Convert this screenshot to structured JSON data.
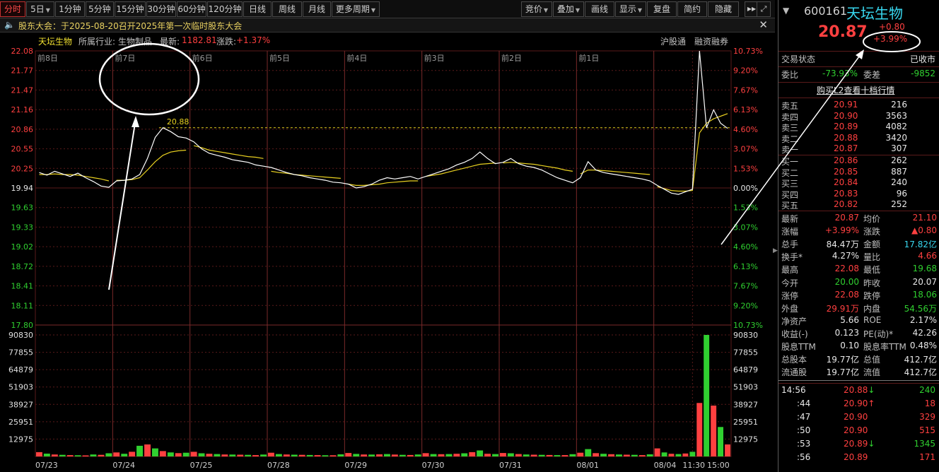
{
  "toolbar": {
    "left_buttons": [
      {
        "label": "分时",
        "active": true
      },
      {
        "label": "5日",
        "caret": true
      },
      {
        "label": "1分钟"
      },
      {
        "label": "5分钟"
      },
      {
        "label": "15分钟"
      },
      {
        "label": "30分钟"
      },
      {
        "label": "60分钟"
      },
      {
        "label": "120分钟"
      },
      {
        "label": "日线"
      },
      {
        "label": "周线"
      },
      {
        "label": "月线"
      },
      {
        "label": "更多周期",
        "caret": true
      }
    ],
    "right_buttons": [
      {
        "label": "竞价",
        "caret": true
      },
      {
        "label": "叠加",
        "caret": true
      },
      {
        "label": "画线"
      },
      {
        "label": "显示",
        "caret": true
      },
      {
        "label": "复盘"
      },
      {
        "label": "简约"
      },
      {
        "label": "隐藏"
      }
    ]
  },
  "notice": {
    "text": "股东大会：于2025-08-20召开2025年第一次临时股东大会"
  },
  "chart_info": {
    "name": "天坛生物",
    "industry_label": "所属行业:",
    "industry": "生物制品",
    "latest_label": "最新:",
    "latest": "1182.81",
    "change_label": "涨跌:",
    "change": "+1.37%",
    "tag1": "沪股通",
    "tag2": "融资融券",
    "peak_label": "20.88"
  },
  "chart_data": {
    "type": "line",
    "price_axis": [
      "22.08",
      "21.77",
      "21.47",
      "21.16",
      "20.86",
      "20.55",
      "20.25",
      "19.94",
      "19.63",
      "19.33",
      "19.02",
      "18.72",
      "18.41",
      "18.11",
      "17.80"
    ],
    "pct_axis": [
      "10.73%",
      "9.20%",
      "7.67%",
      "6.13%",
      "4.60%",
      "3.07%",
      "1.53%",
      "0.00%",
      "1.53%",
      "3.07%",
      "4.60%",
      "6.13%",
      "7.67%",
      "9.20%",
      "10.73%"
    ],
    "volume_axis": [
      "90830",
      "77855",
      "64879",
      "51903",
      "38927",
      "25951",
      "12975"
    ],
    "day_labels": [
      "前8日",
      "前7日",
      "前6日",
      "前5日",
      "前4日",
      "前3日",
      "前2日",
      "前1日"
    ],
    "date_labels": [
      "07/23",
      "07/24",
      "07/25",
      "07/28",
      "07/29",
      "07/30",
      "07/31",
      "08/01",
      "08/04",
      "11:30",
      "15:00"
    ],
    "prev_close": 20.07,
    "ylim": [
      17.8,
      22.08
    ],
    "volume_max": 90830,
    "reference_line": 20.88,
    "days": [
      {
        "price": [
          20.18,
          20.14,
          20.2,
          20.16,
          20.12,
          20.17,
          20.1,
          20.04,
          19.97,
          19.95
        ],
        "avg": [
          20.15,
          20.15,
          20.16,
          20.15,
          20.15,
          20.14,
          20.12,
          20.1,
          20.08,
          20.05
        ]
      },
      {
        "price": [
          20.05,
          20.06,
          20.08,
          20.15,
          20.4,
          20.73,
          20.88,
          20.82,
          20.74,
          20.72
        ],
        "avg": [
          20.06,
          20.06,
          20.07,
          20.1,
          20.22,
          20.35,
          20.45,
          20.5,
          20.52,
          20.53
        ]
      },
      {
        "price": [
          20.66,
          20.55,
          20.48,
          20.45,
          20.42,
          20.38,
          20.36,
          20.34,
          20.3,
          20.28
        ],
        "avg": [
          20.6,
          20.57,
          20.53,
          20.51,
          20.49,
          20.47,
          20.45,
          20.43,
          20.42,
          20.4
        ]
      },
      {
        "price": [
          20.26,
          20.22,
          20.18,
          20.15,
          20.13,
          20.1,
          20.08,
          20.06,
          20.03,
          20.02
        ],
        "avg": [
          20.2,
          20.18,
          20.17,
          20.15,
          20.14,
          20.13,
          20.12,
          20.11,
          20.1,
          20.09
        ]
      },
      {
        "price": [
          20.0,
          19.94,
          19.96,
          20.0,
          20.06,
          20.1,
          20.08,
          20.1,
          20.12,
          20.08
        ],
        "avg": [
          20.0,
          19.98,
          19.98,
          19.99,
          20.0,
          20.02,
          20.03,
          20.04,
          20.05,
          20.05
        ]
      },
      {
        "price": [
          20.12,
          20.16,
          20.2,
          20.24,
          20.3,
          20.34,
          20.4,
          20.5,
          20.4,
          20.32
        ],
        "avg": [
          20.12,
          20.14,
          20.16,
          20.19,
          20.22,
          20.25,
          20.28,
          20.31,
          20.32,
          20.33
        ]
      },
      {
        "price": [
          20.34,
          20.4,
          20.32,
          20.28,
          20.26,
          20.22,
          20.16,
          20.1,
          20.06,
          20.02
        ],
        "avg": [
          20.33,
          20.34,
          20.33,
          20.32,
          20.31,
          20.29,
          20.27,
          20.25,
          20.22,
          20.2
        ]
      },
      {
        "price": [
          20.1,
          20.35,
          20.22,
          20.18,
          20.16,
          20.14,
          20.12,
          20.1,
          20.08,
          20.05
        ],
        "avg": [
          20.16,
          20.22,
          20.22,
          20.21,
          20.2,
          20.19,
          20.18,
          20.17,
          20.16,
          20.15
        ]
      },
      {
        "price": [
          19.98,
          19.92,
          19.86,
          19.84,
          19.88,
          19.92,
          22.08,
          20.88,
          21.16,
          20.95,
          20.87
        ],
        "avg": [
          19.96,
          19.93,
          19.9,
          19.89,
          19.89,
          19.9,
          20.8,
          20.95,
          21.02,
          21.06,
          21.1
        ]
      }
    ],
    "volume": {
      "days": [
        [
          3200,
          2100,
          1500,
          1200,
          1000,
          900,
          800,
          1500,
          1200,
          2400
        ],
        [
          3000,
          2000,
          3500,
          8000,
          9000,
          6000,
          4000,
          3000,
          2500,
          2800
        ],
        [
          3500,
          2400,
          2000,
          1800,
          1500,
          1400,
          1300,
          1200,
          1000,
          1400
        ],
        [
          2800,
          1800,
          1500,
          1300,
          1200,
          1100,
          1000,
          900,
          900,
          1600
        ],
        [
          2600,
          1900,
          1500,
          1400,
          1600,
          1800,
          1400,
          1200,
          1100,
          1500
        ],
        [
          2500,
          1800,
          1700,
          1800,
          2000,
          2400,
          3200,
          4500,
          2000,
          1800
        ],
        [
          2600,
          2400,
          1800,
          1500,
          1300,
          1200,
          1100,
          1000,
          1000,
          1700
        ],
        [
          2800,
          5500,
          2500,
          2000,
          1700,
          1500,
          1300,
          1200,
          1000,
          1600
        ],
        [
          6000,
          3000,
          2000,
          1800,
          2200,
          3500,
          40000,
          90830,
          38000,
          22000,
          9000
        ]
      ]
    }
  },
  "annotation": {
    "pct_badge": "+3.99%"
  },
  "quote": {
    "code": "600161",
    "name": "天坛生物",
    "price": "20.87",
    "change": "+0.80",
    "pct": "+3.99%",
    "status_label": "交易状态",
    "status_value": "已收市",
    "wb_label": "委比",
    "wb_value": "-73.93%",
    "wc_label": "委差",
    "wc_value": "-9852",
    "link": "购买L2查看十档行情",
    "asks": [
      {
        "label": "卖五",
        "price": "20.91",
        "vol": "216"
      },
      {
        "label": "卖四",
        "price": "20.90",
        "vol": "3563"
      },
      {
        "label": "卖三",
        "price": "20.89",
        "vol": "4082"
      },
      {
        "label": "卖二",
        "price": "20.88",
        "vol": "3420"
      },
      {
        "label": "卖一",
        "price": "20.87",
        "vol": "307"
      }
    ],
    "bids": [
      {
        "label": "买一",
        "price": "20.86",
        "vol": "262"
      },
      {
        "label": "买二",
        "price": "20.85",
        "vol": "887"
      },
      {
        "label": "买三",
        "price": "20.84",
        "vol": "240"
      },
      {
        "label": "买四",
        "price": "20.83",
        "vol": "96"
      },
      {
        "label": "买五",
        "price": "20.82",
        "vol": "252"
      }
    ],
    "stats": [
      {
        "l1": "最新",
        "v1": "20.87",
        "c1": "red",
        "l2": "均价",
        "v2": "21.10",
        "c2": "red"
      },
      {
        "l1": "涨幅",
        "v1": "+3.99%",
        "c1": "red",
        "l2": "涨跌",
        "v2": "▲0.80",
        "c2": "red"
      },
      {
        "l1": "总手",
        "v1": "84.47万",
        "c1": "white",
        "l2": "金额",
        "v2": "17.82亿",
        "c2": "cyan"
      },
      {
        "l1": "换手*",
        "v1": "4.27%",
        "c1": "white",
        "l2": "量比",
        "v2": "4.66",
        "c2": "red"
      },
      {
        "l1": "最高",
        "v1": "22.08",
        "c1": "red",
        "l2": "最低",
        "v2": "19.68",
        "c2": "green"
      },
      {
        "l1": "今开",
        "v1": "20.00",
        "c1": "green",
        "l2": "昨收",
        "v2": "20.07",
        "c2": "white"
      },
      {
        "l1": "涨停",
        "v1": "22.08",
        "c1": "red",
        "l2": "跌停",
        "v2": "18.06",
        "c2": "green"
      },
      {
        "l1": "外盘",
        "v1": "29.91万",
        "c1": "red",
        "l2": "内盘",
        "v2": "54.56万",
        "c2": "green"
      },
      {
        "l1": "净资产",
        "v1": "5.66",
        "c1": "white",
        "l2": "ROE",
        "v2": "2.17%",
        "c2": "white"
      },
      {
        "l1": "收益(-)",
        "v1": "0.123",
        "c1": "white",
        "l2": "PE(动)*",
        "v2": "42.26",
        "c2": "white"
      },
      {
        "l1": "股息TTM",
        "v1": "0.10",
        "c1": "white",
        "l2": "股息率TTM",
        "v2": "0.48%",
        "c2": "white"
      },
      {
        "l1": "总股本",
        "v1": "19.77亿",
        "c1": "white",
        "l2": "总值",
        "v2": "412.7亿",
        "c2": "white"
      },
      {
        "l1": "流通股",
        "v1": "19.77亿",
        "c1": "white",
        "l2": "流值",
        "v2": "412.7亿",
        "c2": "white"
      }
    ],
    "ticks": [
      {
        "time": "14:56",
        "price": "20.88",
        "arrow": "down",
        "vol": "240",
        "vc": "green"
      },
      {
        "time": ":44",
        "price": "20.90",
        "arrow": "up",
        "vol": "18",
        "vc": "red"
      },
      {
        "time": ":47",
        "price": "20.90",
        "arrow": "",
        "vol": "329",
        "vc": "red"
      },
      {
        "time": ":50",
        "price": "20.90",
        "arrow": "",
        "vol": "515",
        "vc": "red"
      },
      {
        "time": ":53",
        "price": "20.89",
        "arrow": "down",
        "vol": "1345",
        "vc": "green"
      },
      {
        "time": ":56",
        "price": "20.89",
        "arrow": "",
        "vol": "171",
        "vc": "red"
      }
    ]
  },
  "colors": {
    "up": "#ff4040",
    "down": "#30d030",
    "price_line": "#ffffff",
    "avg_line": "#e8d020",
    "grid": "#5a1a1a"
  }
}
